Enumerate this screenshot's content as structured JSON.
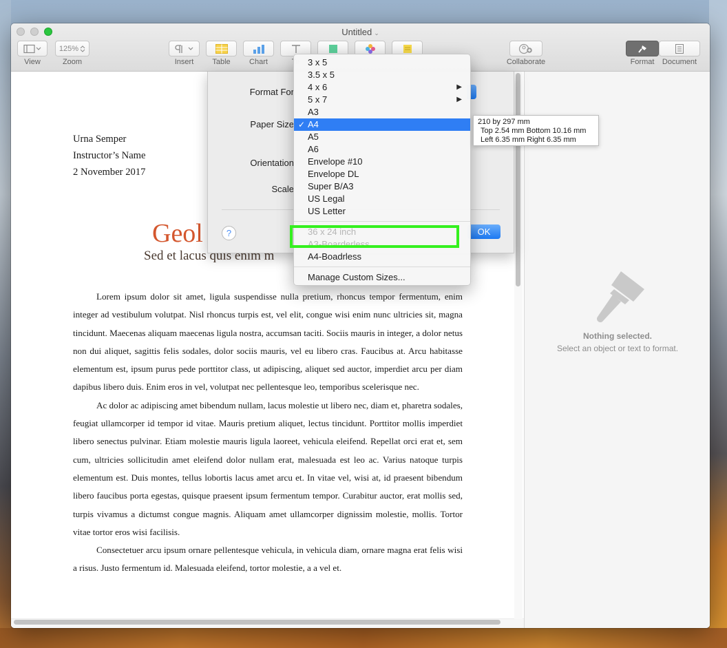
{
  "window": {
    "title": "Untitled"
  },
  "toolbar": {
    "view_label": "View",
    "zoom_value": "125%",
    "zoom_label": "Zoom",
    "insert_label": "Insert",
    "table_label": "Table",
    "chart_label": "Chart",
    "text_label": "Te",
    "collaborate_label": "Collaborate",
    "format_label": "Format",
    "document_label": "Document"
  },
  "sheet": {
    "format_for_label": "Format For",
    "paper_size_label": "Paper Size",
    "orientation_label": "Orientation",
    "scale_label": "Scale",
    "help_label": "?",
    "ok_label": "OK"
  },
  "paper_menu": {
    "items": [
      {
        "label": "3 x 5"
      },
      {
        "label": "3.5 x 5"
      },
      {
        "label": "4 x 6"
      },
      {
        "label": "5 x 7"
      },
      {
        "label": "A3"
      },
      {
        "label": "A4"
      },
      {
        "label": "A5"
      },
      {
        "label": "A6"
      },
      {
        "label": "Envelope #10"
      },
      {
        "label": "Envelope DL"
      },
      {
        "label": "Super B/A3"
      },
      {
        "label": "US Legal"
      },
      {
        "label": "US Letter"
      }
    ],
    "selected": "A4",
    "checkmark": "✓",
    "submenu_arrow": "▶",
    "disabled_items": [
      {
        "label": "36 x 24 inch"
      },
      {
        "label": "A3-Boarderless"
      }
    ],
    "borderless_item": "A4-Boadrless",
    "manage_label": "Manage Custom Sizes..."
  },
  "tooltip": {
    "line1": "210 by 297 mm",
    "line2": "Top 2.54 mm Bottom 10.16 mm",
    "line3": "Left 6.35 mm Right 6.35 mm"
  },
  "document": {
    "author": "Urna Semper",
    "instructor": "Instructor’s Name",
    "date": "2 November 2017",
    "title_visible": "Geol",
    "subtitle_visible": "Sed et lacus quis enim m",
    "paragraphs": [
      "Lorem ipsum dolor sit amet, ligula suspendisse nulla pretium, rhoncus tempor fermentum, enim integer ad vestibulum volutpat. Nisl rhoncus turpis est, vel elit, congue wisi enim nunc ultricies sit, magna tincidunt. Maecenas aliquam maecenas ligula nostra, accumsan taciti. Sociis mauris in integer, a dolor netus non dui aliquet, sagittis felis sodales, dolor sociis mauris, vel eu libero cras. Faucibus at. Arcu habitasse elementum est, ipsum purus pede porttitor class, ut adipiscing, aliquet sed auctor, imperdiet arcu per diam dapibus libero duis. Enim eros in vel, volutpat nec pellentesque leo, temporibus scelerisque nec.",
      "Ac dolor ac adipiscing amet bibendum nullam, lacus molestie ut libero nec, diam et, pharetra sodales, feugiat ullamcorper id tempor id vitae. Mauris pretium aliquet, lectus tincidunt. Porttitor mollis imperdiet libero senectus pulvinar. Etiam molestie mauris ligula laoreet, vehicula eleifend. Repellat orci erat et, sem cum, ultricies sollicitudin amet eleifend dolor nullam erat, malesuada est leo ac. Varius natoque turpis elementum est. Duis montes, tellus lobortis lacus amet arcu et. In vitae vel, wisi at, id praesent bibendum libero faucibus porta egestas, quisque praesent ipsum fermentum tempor. Curabitur auctor, erat mollis sed, turpis vivamus a dictumst congue magnis. Aliquam amet ullamcorper dignissim molestie, mollis. Tortor vitae tortor eros wisi facilisis.",
      "Consectetuer arcu ipsum ornare pellentesque vehicula, in vehicula diam, ornare magna erat felis wisi a risus. Justo fermentum id. Malesuada eleifend, tortor molestie, a a vel et."
    ]
  },
  "sidebar": {
    "empty_title": "Nothing selected.",
    "empty_subtitle": "Select an object or text to format."
  },
  "colors": {
    "accent": "#2f7ef4",
    "title_orange": "#d4572e",
    "highlight_green": "#35f01f"
  }
}
